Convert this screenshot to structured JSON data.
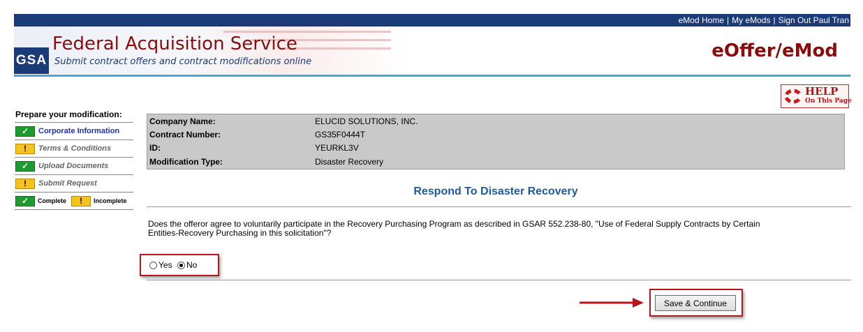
{
  "top_nav": {
    "links": [
      "eMod Home",
      "My eMods",
      "Sign Out Paul Tran"
    ],
    "separator": "|"
  },
  "header": {
    "logo_text": "GSA",
    "title": "Federal Acquisition Service",
    "subtitle": "Submit contract offers and contract modifications online",
    "app_name": "eOffer/eMod"
  },
  "help": {
    "label": "HELP",
    "sublabel": "On This Page",
    "icon": "lifebuoy-icon"
  },
  "sidebar": {
    "title": "Prepare your modification:",
    "items": [
      {
        "label": "Corporate Information",
        "status": "complete",
        "icon": "check-icon"
      },
      {
        "label": "Terms & Conditions",
        "status": "incomplete",
        "icon": "exclamation-icon"
      },
      {
        "label": "Upload Documents",
        "status": "complete",
        "icon": "check-icon"
      },
      {
        "label": "Submit Request",
        "status": "incomplete",
        "icon": "exclamation-icon"
      }
    ],
    "legend": {
      "complete": "Complete",
      "incomplete": "Incomplete"
    }
  },
  "info": [
    {
      "label": "Company Name:",
      "value": "ELUCID SOLUTIONS, INC."
    },
    {
      "label": "Contract Number:",
      "value": "GS35F0444T"
    },
    {
      "label": "ID:",
      "value": "YEURKL3V"
    },
    {
      "label": "Modification Type:",
      "value": "Disaster Recovery"
    }
  ],
  "main": {
    "section_title": "Respond To Disaster Recovery",
    "question_line1": "Does the offeror agree to voluntarily participate in the Recovery Purchasing Program as described in GSAR 552.238-80, \"Use of Federal Supply Contracts by Certain",
    "question_line2": "Entities-Recovery Purchasing in this solicitation\"?",
    "options": [
      {
        "label": "Yes",
        "selected": false
      },
      {
        "label": "No",
        "selected": true
      }
    ],
    "save_label": "Save & Continue"
  },
  "colors": {
    "nav_blue": "#1b3a78",
    "brand_red": "#8b0c0c",
    "accent_blue": "#4aa3d9",
    "title_blue": "#1d5b9e",
    "highlight_red": "#b5161a",
    "complete_green": "#1e9b2e",
    "incomplete_yellow": "#f6c31a"
  }
}
